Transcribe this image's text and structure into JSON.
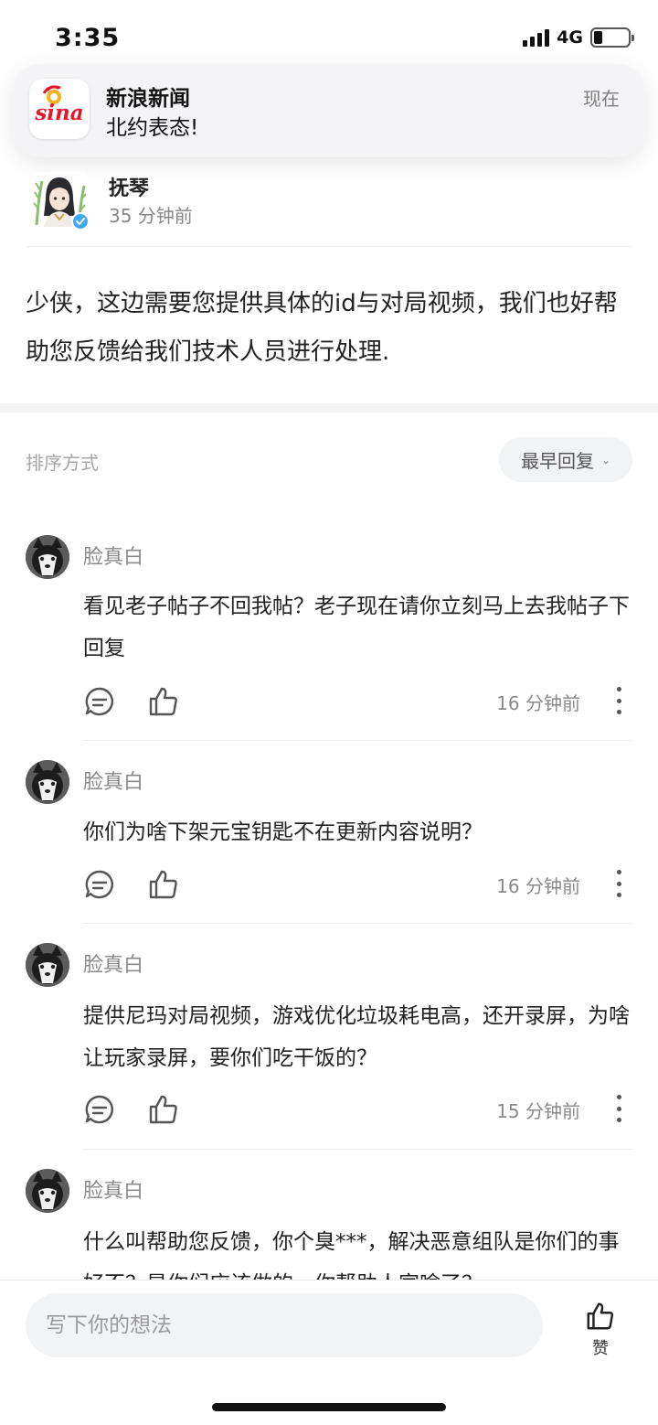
{
  "status_bar": {
    "time": "3:35",
    "network": "4G",
    "battery_fraction": 0.25,
    "signal_bars": 4
  },
  "notification": {
    "app_name": "新浪新闻",
    "message": "北约表态!",
    "time": "现在",
    "logo_text": "sina",
    "icon": "sina-logo-icon"
  },
  "author": {
    "name": "抚琴",
    "time": "35 分钟前",
    "verified": true
  },
  "post": {
    "body": "少侠，这边需要您提供具体的id与对局视频，我们也好帮助您反馈给我们技术人员进行处理."
  },
  "sort": {
    "label": "排序方式",
    "selected": "最早回复"
  },
  "comments": [
    {
      "user": "脸真白",
      "text": "看见老子帖子不回我帖？老子现在请你立刻马上去我帖子下回复",
      "time": "16 分钟前"
    },
    {
      "user": "脸真白",
      "text": "你们为啥下架元宝钥匙不在更新内容说明？",
      "time": "16 分钟前"
    },
    {
      "user": "脸真白",
      "text": "提供尼玛对局视频，游戏优化垃圾耗电高，还开录屏，为啥让玩家录屏，要你们吃干饭的？",
      "time": "15 分钟前"
    },
    {
      "user": "脸真白",
      "text": "什么叫帮助您反馈，你个臭***，解决恶意组队是你们的事好不？是你们应该做的，你帮助人家啥了？",
      "time": ""
    }
  ],
  "bottom_bar": {
    "input_placeholder": "写下你的想法",
    "like_label": "赞"
  },
  "colors": {
    "background": "#ffffff",
    "divider_band": "#f3f3f3",
    "pill_bg": "#f2f3f5",
    "muted_text": "#8a8a8a",
    "verified_badge": "#3fa8f5",
    "sina_red": "#e6162d"
  }
}
